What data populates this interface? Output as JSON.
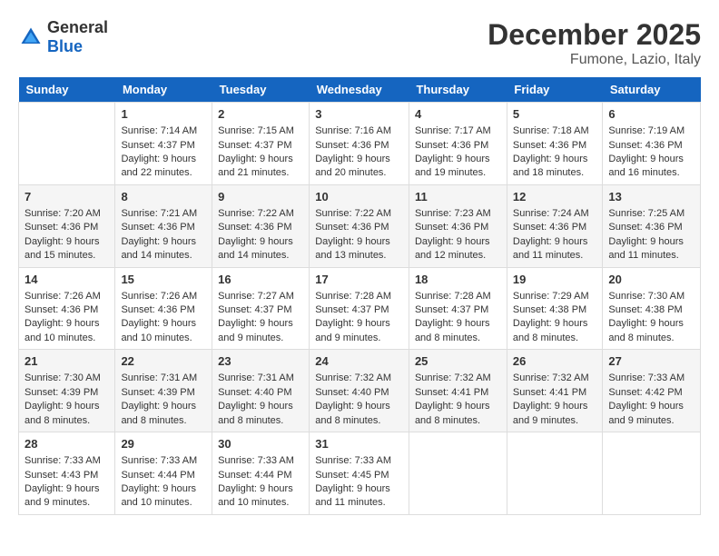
{
  "header": {
    "logo_general": "General",
    "logo_blue": "Blue",
    "month_year": "December 2025",
    "location": "Fumone, Lazio, Italy"
  },
  "days_of_week": [
    "Sunday",
    "Monday",
    "Tuesday",
    "Wednesday",
    "Thursday",
    "Friday",
    "Saturday"
  ],
  "weeks": [
    [
      {
        "day": "",
        "sunrise": "",
        "sunset": "",
        "daylight": ""
      },
      {
        "day": "1",
        "sunrise": "Sunrise: 7:14 AM",
        "sunset": "Sunset: 4:37 PM",
        "daylight": "Daylight: 9 hours and 22 minutes."
      },
      {
        "day": "2",
        "sunrise": "Sunrise: 7:15 AM",
        "sunset": "Sunset: 4:37 PM",
        "daylight": "Daylight: 9 hours and 21 minutes."
      },
      {
        "day": "3",
        "sunrise": "Sunrise: 7:16 AM",
        "sunset": "Sunset: 4:36 PM",
        "daylight": "Daylight: 9 hours and 20 minutes."
      },
      {
        "day": "4",
        "sunrise": "Sunrise: 7:17 AM",
        "sunset": "Sunset: 4:36 PM",
        "daylight": "Daylight: 9 hours and 19 minutes."
      },
      {
        "day": "5",
        "sunrise": "Sunrise: 7:18 AM",
        "sunset": "Sunset: 4:36 PM",
        "daylight": "Daylight: 9 hours and 18 minutes."
      },
      {
        "day": "6",
        "sunrise": "Sunrise: 7:19 AM",
        "sunset": "Sunset: 4:36 PM",
        "daylight": "Daylight: 9 hours and 16 minutes."
      }
    ],
    [
      {
        "day": "7",
        "sunrise": "Sunrise: 7:20 AM",
        "sunset": "Sunset: 4:36 PM",
        "daylight": "Daylight: 9 hours and 15 minutes."
      },
      {
        "day": "8",
        "sunrise": "Sunrise: 7:21 AM",
        "sunset": "Sunset: 4:36 PM",
        "daylight": "Daylight: 9 hours and 14 minutes."
      },
      {
        "day": "9",
        "sunrise": "Sunrise: 7:22 AM",
        "sunset": "Sunset: 4:36 PM",
        "daylight": "Daylight: 9 hours and 14 minutes."
      },
      {
        "day": "10",
        "sunrise": "Sunrise: 7:22 AM",
        "sunset": "Sunset: 4:36 PM",
        "daylight": "Daylight: 9 hours and 13 minutes."
      },
      {
        "day": "11",
        "sunrise": "Sunrise: 7:23 AM",
        "sunset": "Sunset: 4:36 PM",
        "daylight": "Daylight: 9 hours and 12 minutes."
      },
      {
        "day": "12",
        "sunrise": "Sunrise: 7:24 AM",
        "sunset": "Sunset: 4:36 PM",
        "daylight": "Daylight: 9 hours and 11 minutes."
      },
      {
        "day": "13",
        "sunrise": "Sunrise: 7:25 AM",
        "sunset": "Sunset: 4:36 PM",
        "daylight": "Daylight: 9 hours and 11 minutes."
      }
    ],
    [
      {
        "day": "14",
        "sunrise": "Sunrise: 7:26 AM",
        "sunset": "Sunset: 4:36 PM",
        "daylight": "Daylight: 9 hours and 10 minutes."
      },
      {
        "day": "15",
        "sunrise": "Sunrise: 7:26 AM",
        "sunset": "Sunset: 4:36 PM",
        "daylight": "Daylight: 9 hours and 10 minutes."
      },
      {
        "day": "16",
        "sunrise": "Sunrise: 7:27 AM",
        "sunset": "Sunset: 4:37 PM",
        "daylight": "Daylight: 9 hours and 9 minutes."
      },
      {
        "day": "17",
        "sunrise": "Sunrise: 7:28 AM",
        "sunset": "Sunset: 4:37 PM",
        "daylight": "Daylight: 9 hours and 9 minutes."
      },
      {
        "day": "18",
        "sunrise": "Sunrise: 7:28 AM",
        "sunset": "Sunset: 4:37 PM",
        "daylight": "Daylight: 9 hours and 8 minutes."
      },
      {
        "day": "19",
        "sunrise": "Sunrise: 7:29 AM",
        "sunset": "Sunset: 4:38 PM",
        "daylight": "Daylight: 9 hours and 8 minutes."
      },
      {
        "day": "20",
        "sunrise": "Sunrise: 7:30 AM",
        "sunset": "Sunset: 4:38 PM",
        "daylight": "Daylight: 9 hours and 8 minutes."
      }
    ],
    [
      {
        "day": "21",
        "sunrise": "Sunrise: 7:30 AM",
        "sunset": "Sunset: 4:39 PM",
        "daylight": "Daylight: 9 hours and 8 minutes."
      },
      {
        "day": "22",
        "sunrise": "Sunrise: 7:31 AM",
        "sunset": "Sunset: 4:39 PM",
        "daylight": "Daylight: 9 hours and 8 minutes."
      },
      {
        "day": "23",
        "sunrise": "Sunrise: 7:31 AM",
        "sunset": "Sunset: 4:40 PM",
        "daylight": "Daylight: 9 hours and 8 minutes."
      },
      {
        "day": "24",
        "sunrise": "Sunrise: 7:32 AM",
        "sunset": "Sunset: 4:40 PM",
        "daylight": "Daylight: 9 hours and 8 minutes."
      },
      {
        "day": "25",
        "sunrise": "Sunrise: 7:32 AM",
        "sunset": "Sunset: 4:41 PM",
        "daylight": "Daylight: 9 hours and 8 minutes."
      },
      {
        "day": "26",
        "sunrise": "Sunrise: 7:32 AM",
        "sunset": "Sunset: 4:41 PM",
        "daylight": "Daylight: 9 hours and 9 minutes."
      },
      {
        "day": "27",
        "sunrise": "Sunrise: 7:33 AM",
        "sunset": "Sunset: 4:42 PM",
        "daylight": "Daylight: 9 hours and 9 minutes."
      }
    ],
    [
      {
        "day": "28",
        "sunrise": "Sunrise: 7:33 AM",
        "sunset": "Sunset: 4:43 PM",
        "daylight": "Daylight: 9 hours and 9 minutes."
      },
      {
        "day": "29",
        "sunrise": "Sunrise: 7:33 AM",
        "sunset": "Sunset: 4:44 PM",
        "daylight": "Daylight: 9 hours and 10 minutes."
      },
      {
        "day": "30",
        "sunrise": "Sunrise: 7:33 AM",
        "sunset": "Sunset: 4:44 PM",
        "daylight": "Daylight: 9 hours and 10 minutes."
      },
      {
        "day": "31",
        "sunrise": "Sunrise: 7:33 AM",
        "sunset": "Sunset: 4:45 PM",
        "daylight": "Daylight: 9 hours and 11 minutes."
      },
      {
        "day": "",
        "sunrise": "",
        "sunset": "",
        "daylight": ""
      },
      {
        "day": "",
        "sunrise": "",
        "sunset": "",
        "daylight": ""
      },
      {
        "day": "",
        "sunrise": "",
        "sunset": "",
        "daylight": ""
      }
    ]
  ]
}
